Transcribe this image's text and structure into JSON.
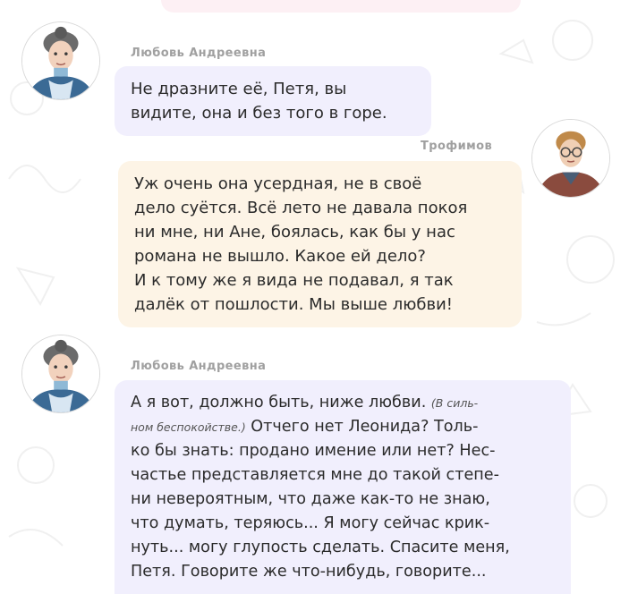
{
  "messages": [
    {
      "speaker": "Любовь Андреевна",
      "side": "left",
      "avatar": "lyubov-portrait",
      "lines": [
        "Не дразните её, Петя, вы",
        "видите, она и без того в горе."
      ]
    },
    {
      "speaker": "Трофимов",
      "side": "right",
      "avatar": "trofimov-portrait",
      "lines": [
        "Уж очень она усердная, не в своё",
        "дело суётся. Всё лето не давала покоя",
        "ни мне, ни Ане, боялась, как бы у нас",
        "романа не вышло. Какое ей дело?",
        "И к тому же я вида не подавал, я так",
        "далёк от пошлости. Мы выше любви!"
      ]
    },
    {
      "speaker": "Любовь Андреевна",
      "side": "left",
      "avatar": "lyubov-portrait",
      "line1_text": "А я вот, должно быть, ниже любви. ",
      "line1_remark": "(В силь-",
      "line2_remark": "ном беспокойстве.)",
      "line2_text": " Отчего нет Леонида? Толь-",
      "lines": [
        "ко бы знать: продано имение или нет? Нес-",
        "частье представляется мне до такой степе-",
        "ни невероятным, что даже как-то не знаю,",
        "что думать, теряюсь... Я могу сейчас крик-",
        "нуть... могу глупость сделать. Спасите меня,",
        "Петя. Говорите же что-нибудь, говорите..."
      ]
    }
  ],
  "colors": {
    "lilac_bubble": "#f1effd",
    "peach_bubble": "#fdf4e6",
    "pink_bubble": "#fdf0f4",
    "speaker_name": "#a0a0a0",
    "text": "#2b2b2b"
  }
}
